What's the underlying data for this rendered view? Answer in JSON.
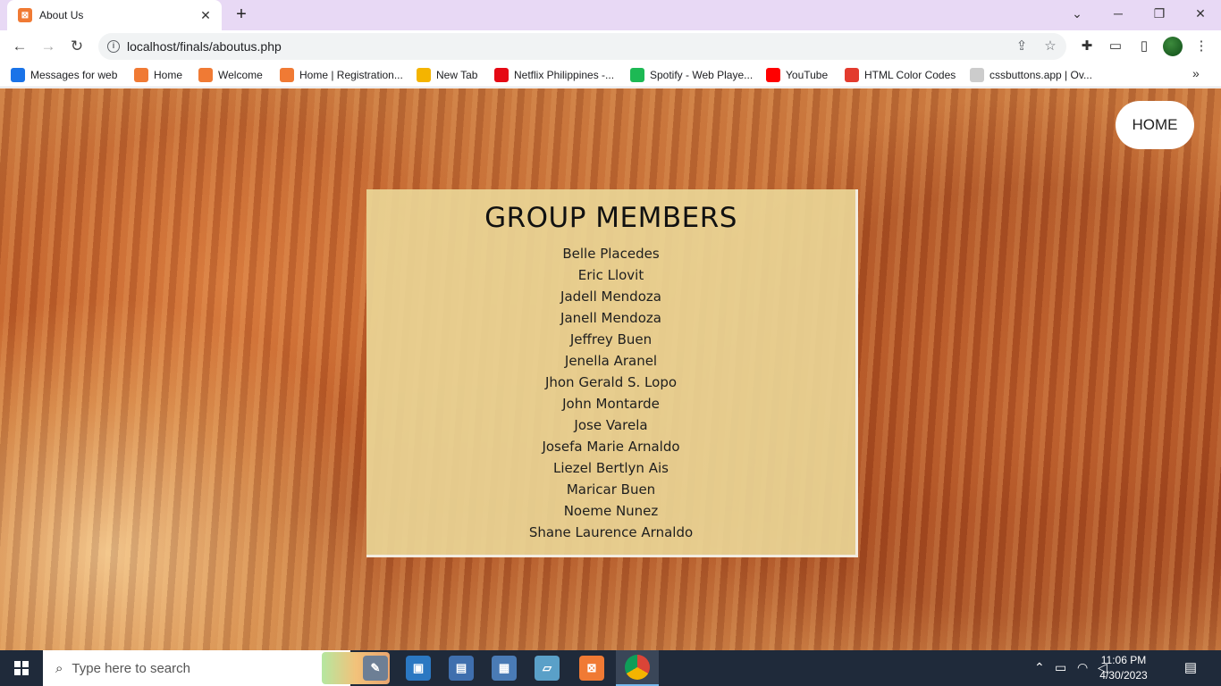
{
  "browser": {
    "tab": {
      "title": "About Us",
      "close_glyph": "✕"
    },
    "new_tab_glyph": "+",
    "address": {
      "url": "localhost/finals/aboutus.php"
    },
    "bookmarks": [
      {
        "label": "Messages for web",
        "icon": "messages-icon",
        "color": "#1a73e8"
      },
      {
        "label": "Home",
        "icon": "xampp-icon",
        "color": "#f07a34"
      },
      {
        "label": "Welcome",
        "icon": "xampp-icon",
        "color": "#f07a34"
      },
      {
        "label": "Home | Registration...",
        "icon": "xampp-icon",
        "color": "#f07a34"
      },
      {
        "label": "New Tab",
        "icon": "newtab-icon",
        "color": "#f4b400"
      },
      {
        "label": "Netflix Philippines -...",
        "icon": "netflix-icon",
        "color": "#e50914"
      },
      {
        "label": "Spotify - Web Playe...",
        "icon": "spotify-icon",
        "color": "#1db954"
      },
      {
        "label": "YouTube",
        "icon": "youtube-icon",
        "color": "#ff0000"
      },
      {
        "label": "HTML Color Codes",
        "icon": "htmlcolor-icon",
        "color": "#e33b2e"
      },
      {
        "label": "cssbuttons.app | Ov...",
        "icon": "cssbuttons-icon",
        "color": "#cccccc"
      }
    ]
  },
  "page": {
    "home_button": "HOME",
    "title": "GROUP MEMBERS",
    "members": [
      "Belle Placedes",
      "Eric Llovit",
      "Jadell Mendoza",
      "Janell Mendoza",
      "Jeffrey Buen",
      "Jenella Aranel",
      "Jhon Gerald S. Lopo",
      "John Montarde",
      "Jose Varela",
      "Josefa Marie Arnaldo",
      "Liezel Bertlyn Ais",
      "Maricar Buen",
      "Noeme Nunez",
      "Shane Laurence Arnaldo"
    ]
  },
  "taskbar": {
    "search_placeholder": "Type here to search",
    "time": "11:06 PM",
    "date": "4/30/2023"
  },
  "colors": {
    "tab_strip": "#e8d9f5",
    "card": "#ead494",
    "taskbar": "#1f2a3a"
  }
}
